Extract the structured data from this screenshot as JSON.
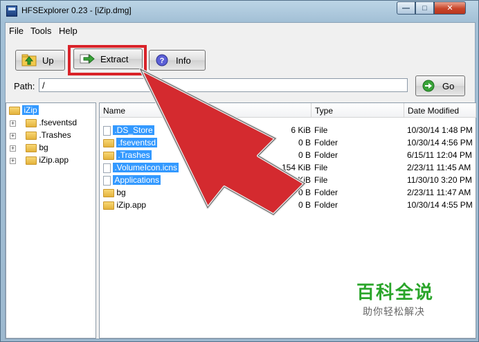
{
  "window": {
    "title": "HFSExplorer 0.23 - [iZip.dmg]"
  },
  "menu": {
    "file": "File",
    "tools": "Tools",
    "help": "Help"
  },
  "toolbar": {
    "up_label": "Up",
    "extract_label": "Extract",
    "info_label": "Info",
    "go_label": "Go"
  },
  "path": {
    "label": "Path:",
    "value": "/"
  },
  "tree": {
    "root": "iZip",
    "items": [
      ".fseventsd",
      ".Trashes",
      "bg",
      "iZip.app"
    ]
  },
  "list": {
    "columns": {
      "name": "Name",
      "type": "Type",
      "date": "Date Modified"
    },
    "rows": [
      {
        "name": ".DS_Store",
        "size": "6 KiB",
        "type": "File",
        "date": "10/30/14 1:48 PM",
        "kind": "file"
      },
      {
        "name": ".fseventsd",
        "size": "0 B",
        "type": "Folder",
        "date": "10/30/14 4:56 PM",
        "kind": "folder"
      },
      {
        "name": ".Trashes",
        "size": "0 B",
        "type": "Folder",
        "date": "6/15/11 12:04 PM",
        "kind": "folder"
      },
      {
        "name": ".VolumeIcon.icns",
        "size": "154 KiB",
        "type": "File",
        "date": "2/23/11 11:45 AM",
        "kind": "file"
      },
      {
        "name": "Applications",
        "size": "4 KiB",
        "type": "File",
        "date": "11/30/10 3:20 PM",
        "kind": "file"
      },
      {
        "name": "bg",
        "size": "0 B",
        "type": "Folder",
        "date": "2/23/11 11:47 AM",
        "kind": "folder"
      },
      {
        "name": "iZip.app",
        "size": "0 B",
        "type": "Folder",
        "date": "10/30/14 4:55 PM",
        "kind": "folder"
      }
    ]
  },
  "watermark": {
    "brand": "百科全说",
    "tagline": "助你轻松解决"
  },
  "colors": {
    "highlight": "#d9232a",
    "selection": "#3399ff",
    "watermark": "#2aa52a"
  }
}
